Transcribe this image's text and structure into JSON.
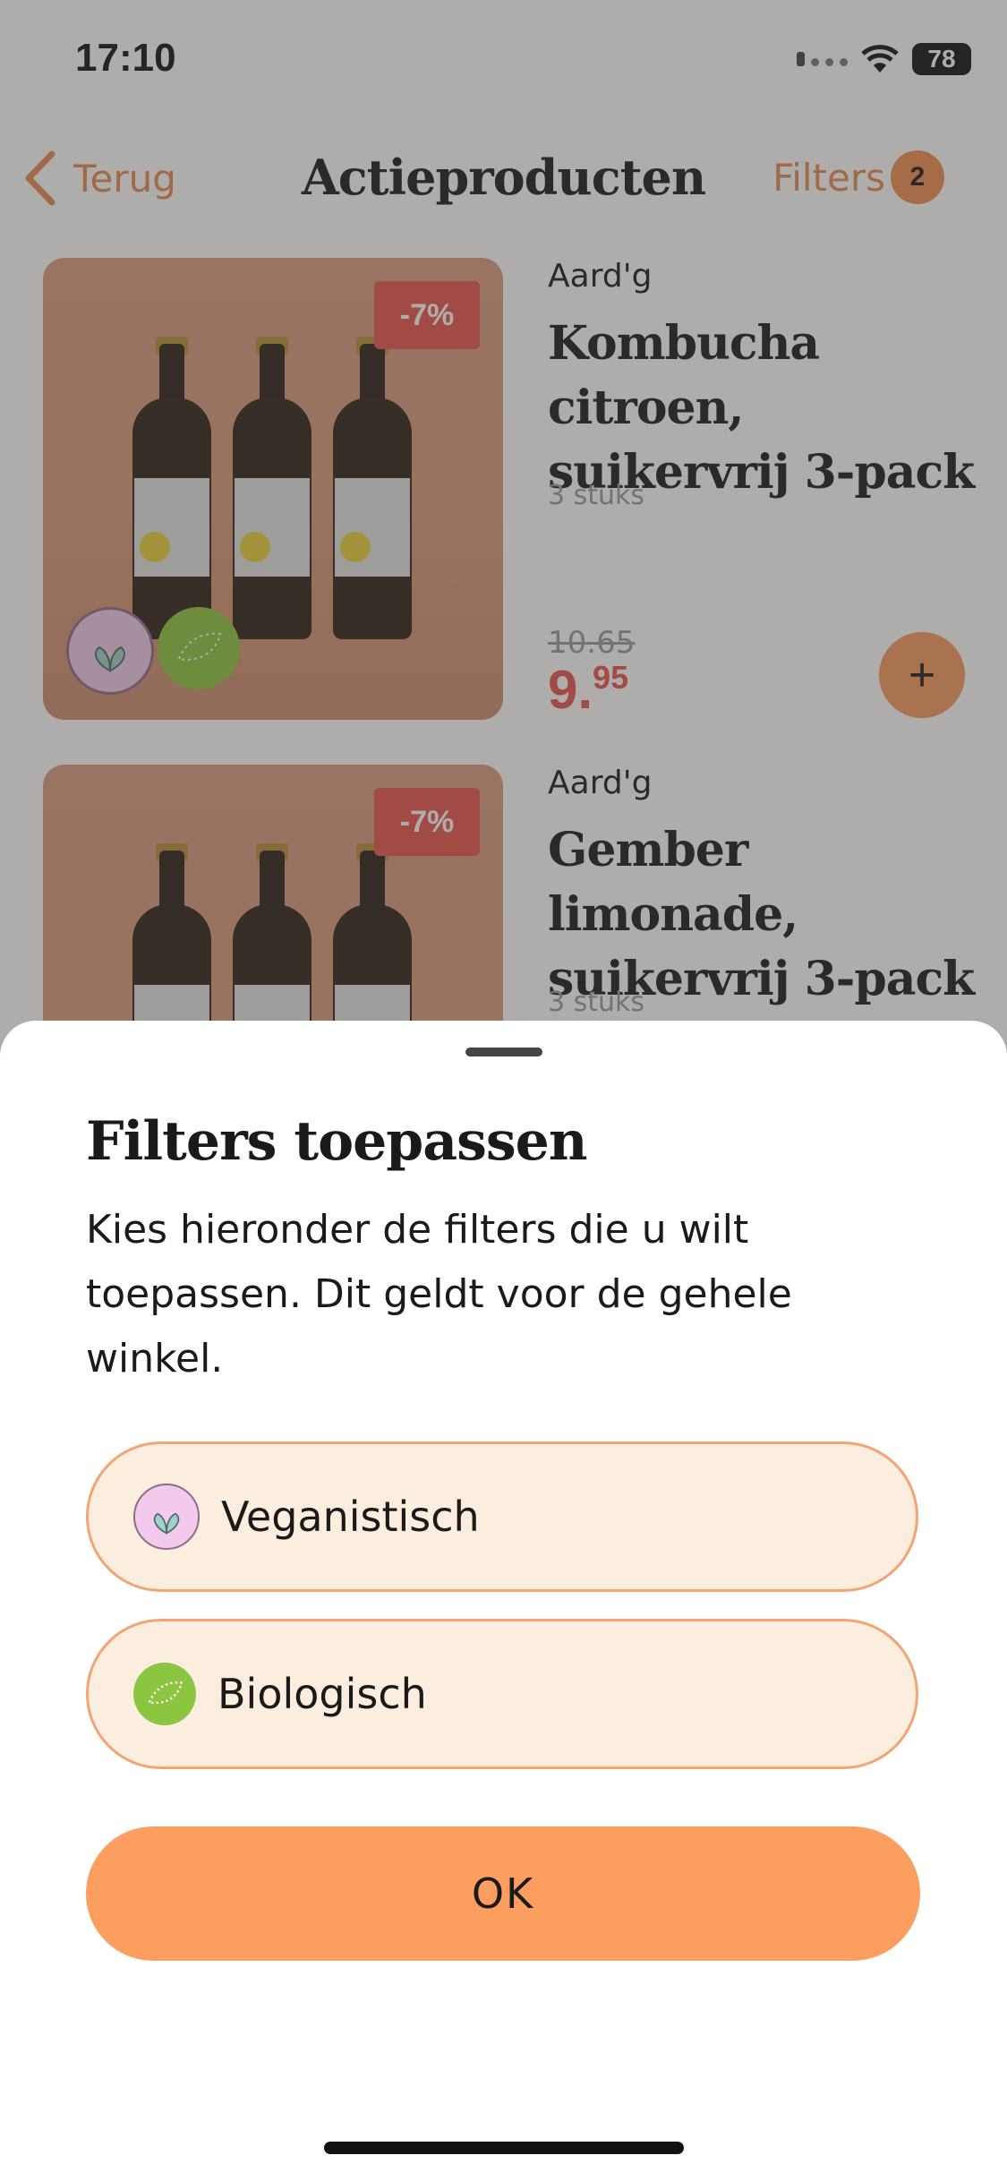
{
  "status_bar": {
    "time": "17:10",
    "battery": "78"
  },
  "nav": {
    "back_label": "Terug",
    "title": "Actieproducten",
    "filters_label": "Filters",
    "filters_count": "2"
  },
  "products": [
    {
      "brand": "Aard'g",
      "name": "Kombucha citroen, suikervrij 3-pack",
      "quantity": "3 stuks",
      "discount": "-7%",
      "old_price": "10.65",
      "price_main": "9.",
      "price_cents": "95",
      "add_label": "+"
    },
    {
      "brand": "Aard'g",
      "name": "Gember limonade, suikervrij 3-pack",
      "quantity": "3 stuks",
      "discount": "-7%"
    }
  ],
  "sheet": {
    "title": "Filters toepassen",
    "description": "Kies hieronder de filters die u wilt toepassen. Dit geldt voor de gehele winkel.",
    "options": [
      {
        "label": "Veganistisch",
        "icon": "vegan-icon"
      },
      {
        "label": "Biologisch",
        "icon": "organic-leaf-icon"
      }
    ],
    "ok_label": "OK"
  },
  "colors": {
    "accent": "#fb9e5f",
    "discount": "#e8534e",
    "option_bg": "#fbeedf",
    "option_border": "#f2a474"
  }
}
